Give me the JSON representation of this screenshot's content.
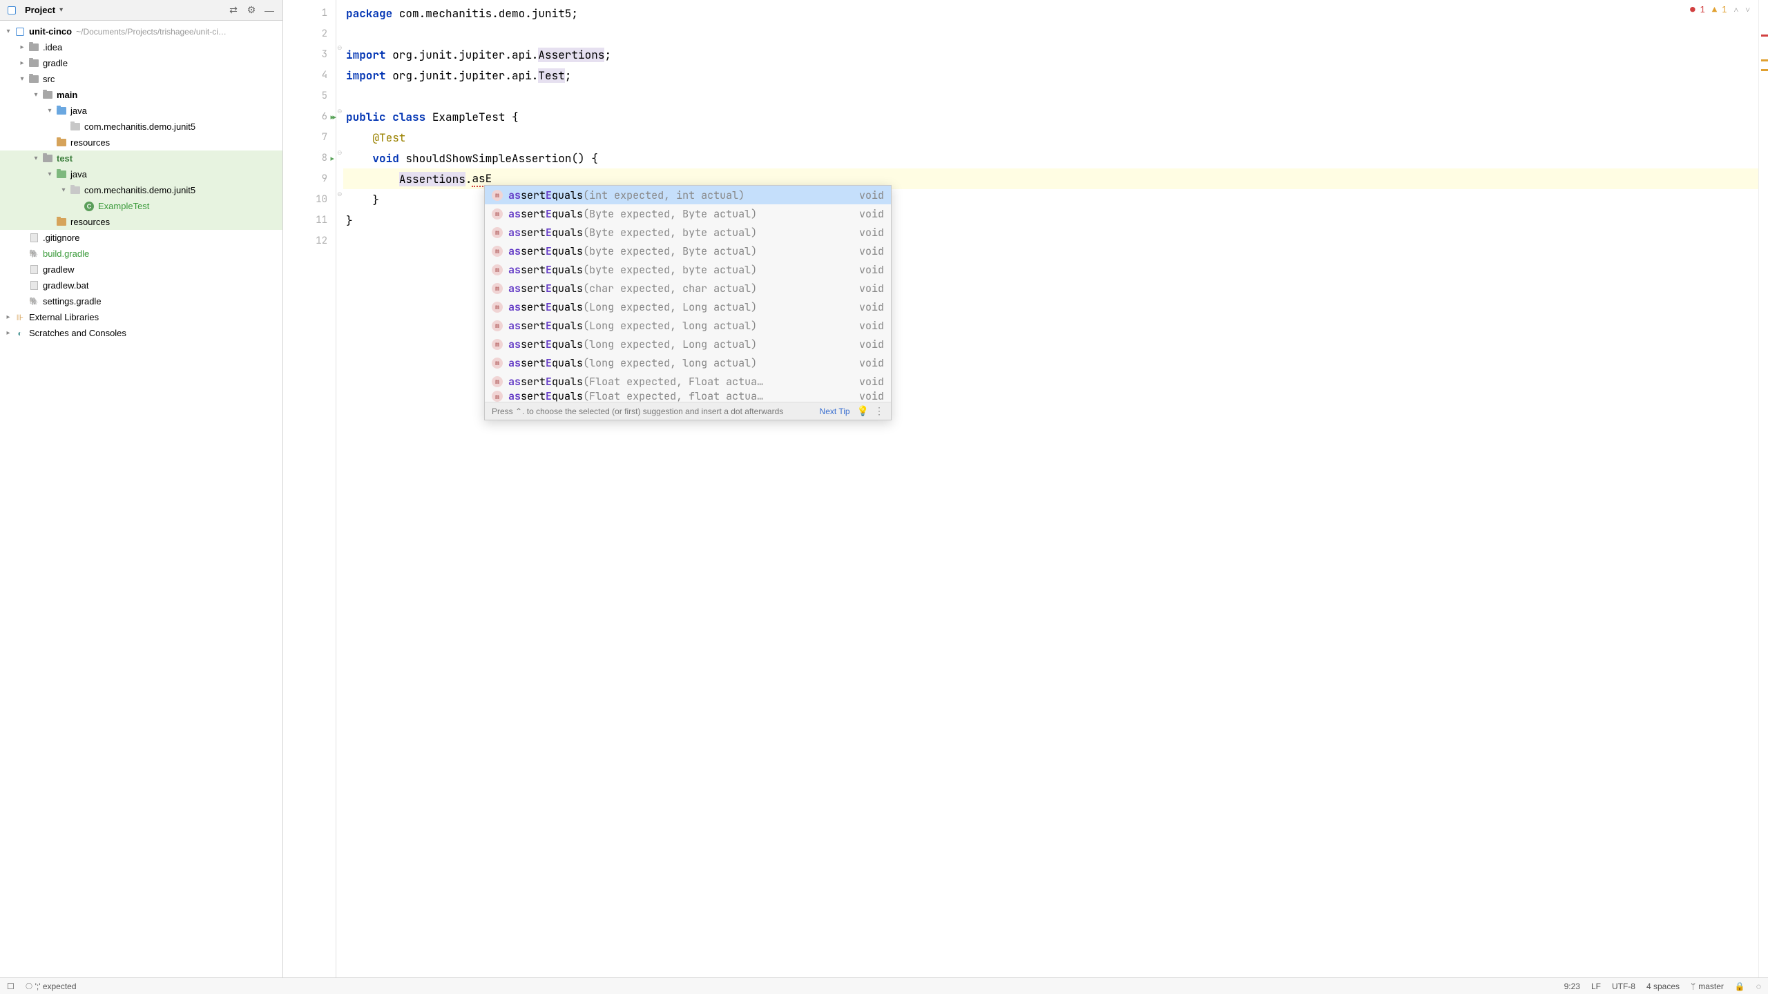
{
  "panel": {
    "title": "Project"
  },
  "tree": {
    "root": {
      "name": "unit-cinco",
      "path": "~/Documents/Projects/trishagee/unit-ci…"
    },
    "idea": ".idea",
    "gradle": "gradle",
    "src": "src",
    "main": "main",
    "main_java": "java",
    "main_pkg": "com.mechanitis.demo.junit5",
    "main_res": "resources",
    "test": "test",
    "test_java": "java",
    "test_pkg": "com.mechanitis.demo.junit5",
    "test_class": "ExampleTest",
    "test_res": "resources",
    "gitignore": ".gitignore",
    "build_gradle": "build.gradle",
    "gradlew": "gradlew",
    "gradlew_bat": "gradlew.bat",
    "settings_gradle": "settings.gradle",
    "ext_lib": "External Libraries",
    "scratches": "Scratches and Consoles"
  },
  "code": {
    "l1": {
      "kw": "package",
      "rest": " com.mechanitis.demo.junit5;"
    },
    "l3": {
      "kw": "import",
      "p1": " org.junit.jupiter.api.",
      "hl": "Assertions",
      "p2": ";"
    },
    "l4": {
      "kw": "import",
      "p1": " org.junit.jupiter.api.",
      "hl": "Test",
      "p2": ";"
    },
    "l6": {
      "kw1": "public",
      "sp": " ",
      "kw2": "class",
      "rest": " ExampleTest {"
    },
    "l7": {
      "ind": "    ",
      "ann": "@Test"
    },
    "l8": {
      "ind": "    ",
      "kw": "void",
      "rest": " shouldShowSimpleAssertion() {"
    },
    "l9": {
      "ind": "        ",
      "obj": "Assertions",
      "dot": ".",
      "typed": "asE"
    },
    "l10": "    }",
    "l11": "}"
  },
  "top_status": {
    "err": "1",
    "warn": "1"
  },
  "completion": {
    "items": [
      {
        "name": "assertEquals",
        "params": "(int expected, int actual)",
        "ret": "void",
        "sel": true
      },
      {
        "name": "assertEquals",
        "params": "(Byte expected, Byte actual)",
        "ret": "void"
      },
      {
        "name": "assertEquals",
        "params": "(Byte expected, byte actual)",
        "ret": "void"
      },
      {
        "name": "assertEquals",
        "params": "(byte expected, Byte actual)",
        "ret": "void"
      },
      {
        "name": "assertEquals",
        "params": "(byte expected, byte actual)",
        "ret": "void"
      },
      {
        "name": "assertEquals",
        "params": "(char expected, char actual)",
        "ret": "void"
      },
      {
        "name": "assertEquals",
        "params": "(Long expected, Long actual)",
        "ret": "void"
      },
      {
        "name": "assertEquals",
        "params": "(Long expected, long actual)",
        "ret": "void"
      },
      {
        "name": "assertEquals",
        "params": "(long expected, Long actual)",
        "ret": "void"
      },
      {
        "name": "assertEquals",
        "params": "(long expected, long actual)",
        "ret": "void"
      },
      {
        "name": "assertEquals",
        "params": "(Float expected, Float actua…",
        "ret": "void"
      },
      {
        "name": "assertEquals",
        "params": "(Float expected, float actua…",
        "ret": "void",
        "cut": true
      }
    ],
    "hint": "Press ⌃. to choose the selected (or first) suggestion and insert a dot afterwards",
    "next_tip": "Next Tip"
  },
  "status": {
    "left": "';' expected",
    "pos": "9:23",
    "le": "LF",
    "enc": "UTF-8",
    "indent": "4 spaces",
    "branch": "master"
  },
  "line_numbers": [
    "1",
    "2",
    "3",
    "4",
    "5",
    "6",
    "7",
    "8",
    "9",
    "10",
    "11",
    "12"
  ]
}
